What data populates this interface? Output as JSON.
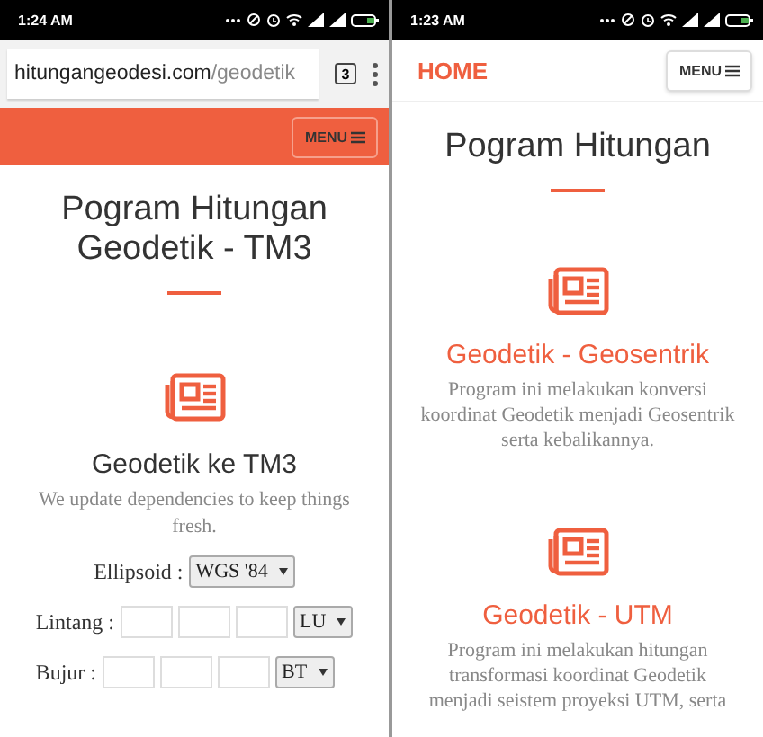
{
  "left_phone": {
    "status_bar": {
      "time": "1:24 AM"
    },
    "browser": {
      "url_domain": "hitungangeodesi.com",
      "url_path": "/geodetik",
      "tab_count": "3"
    },
    "header": {
      "menu_button": "MENU"
    },
    "page_title": "Pogram Hitungan Geodetik - TM3",
    "section": {
      "title": "Geodetik ke TM3",
      "subtitle": "We update dependencies to keep things fresh."
    },
    "form": {
      "ellipsoid": {
        "label": "Ellipsoid :",
        "value": "WGS '84"
      },
      "rows": [
        {
          "label": "Lintang :",
          "direction": "LU"
        },
        {
          "label": "Bujur :",
          "direction": "BT"
        }
      ]
    }
  },
  "right_phone": {
    "status_bar": {
      "time": "1:23 AM"
    },
    "header": {
      "home_link": "HOME",
      "menu_button": "MENU"
    },
    "page_title": "Pogram Hitungan",
    "cards": [
      {
        "title": "Geodetik - Geosentrik",
        "description": "Program ini melakukan konversi koordinat Geodetik menjadi Geosentrik serta kebalikannya."
      },
      {
        "title": "Geodetik - UTM",
        "description": "Program ini melakukan hitungan transformasi koordinat Geodetik menjadi seistem proyeksi UTM, serta"
      }
    ]
  }
}
